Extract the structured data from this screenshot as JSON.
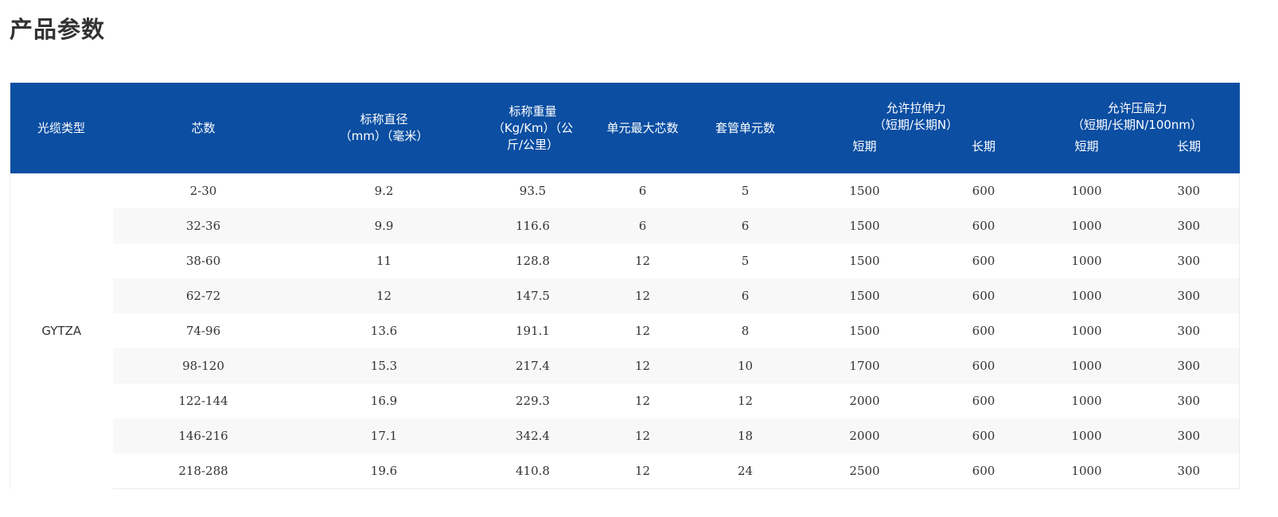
{
  "page_title": "产品参数",
  "table": {
    "headers": {
      "cable_type": "光缆类型",
      "core_count": "芯数",
      "diameter": [
        "标称直径",
        "（mm）（毫米）"
      ],
      "weight": [
        "标称重量",
        "（Kg/Km）（公",
        "斤/公里）"
      ],
      "unit_max_cores": "单元最大芯数",
      "tube_units": "套管单元数",
      "tensile": [
        "允许拉伸力",
        "（短期/长期N）"
      ],
      "crush": [
        "允许压扁力",
        "（短期/长期N/100nm）"
      ],
      "short_term": "短期",
      "long_term": "长期"
    },
    "cable_type_value": "GYTZA",
    "rows": [
      {
        "cores": "2-30",
        "diameter": "9.2",
        "weight": "93.5",
        "unit_max": "6",
        "tubes": "5",
        "tensile_short": "1500",
        "tensile_long": "600",
        "crush_short": "1000",
        "crush_long": "300"
      },
      {
        "cores": "32-36",
        "diameter": "9.9",
        "weight": "116.6",
        "unit_max": "6",
        "tubes": "6",
        "tensile_short": "1500",
        "tensile_long": "600",
        "crush_short": "1000",
        "crush_long": "300"
      },
      {
        "cores": "38-60",
        "diameter": "11",
        "weight": "128.8",
        "unit_max": "12",
        "tubes": "5",
        "tensile_short": "1500",
        "tensile_long": "600",
        "crush_short": "1000",
        "crush_long": "300"
      },
      {
        "cores": "62-72",
        "diameter": "12",
        "weight": "147.5",
        "unit_max": "12",
        "tubes": "6",
        "tensile_short": "1500",
        "tensile_long": "600",
        "crush_short": "1000",
        "crush_long": "300"
      },
      {
        "cores": "74-96",
        "diameter": "13.6",
        "weight": "191.1",
        "unit_max": "12",
        "tubes": "8",
        "tensile_short": "1500",
        "tensile_long": "600",
        "crush_short": "1000",
        "crush_long": "300"
      },
      {
        "cores": "98-120",
        "diameter": "15.3",
        "weight": "217.4",
        "unit_max": "12",
        "tubes": "10",
        "tensile_short": "1700",
        "tensile_long": "600",
        "crush_short": "1000",
        "crush_long": "300"
      },
      {
        "cores": "122-144",
        "diameter": "16.9",
        "weight": "229.3",
        "unit_max": "12",
        "tubes": "12",
        "tensile_short": "2000",
        "tensile_long": "600",
        "crush_short": "1000",
        "crush_long": "300"
      },
      {
        "cores": "146-216",
        "diameter": "17.1",
        "weight": "342.4",
        "unit_max": "12",
        "tubes": "18",
        "tensile_short": "2000",
        "tensile_long": "600",
        "crush_short": "1000",
        "crush_long": "300"
      },
      {
        "cores": "218-288",
        "diameter": "19.6",
        "weight": "410.8",
        "unit_max": "12",
        "tubes": "24",
        "tensile_short": "2500",
        "tensile_long": "600",
        "crush_short": "1000",
        "crush_long": "300"
      }
    ]
  },
  "colors": {
    "header_bg": "#0b4ea2",
    "header_text": "#ffffff",
    "stripe_bg": "#f8f8f8",
    "text": "#333333"
  }
}
